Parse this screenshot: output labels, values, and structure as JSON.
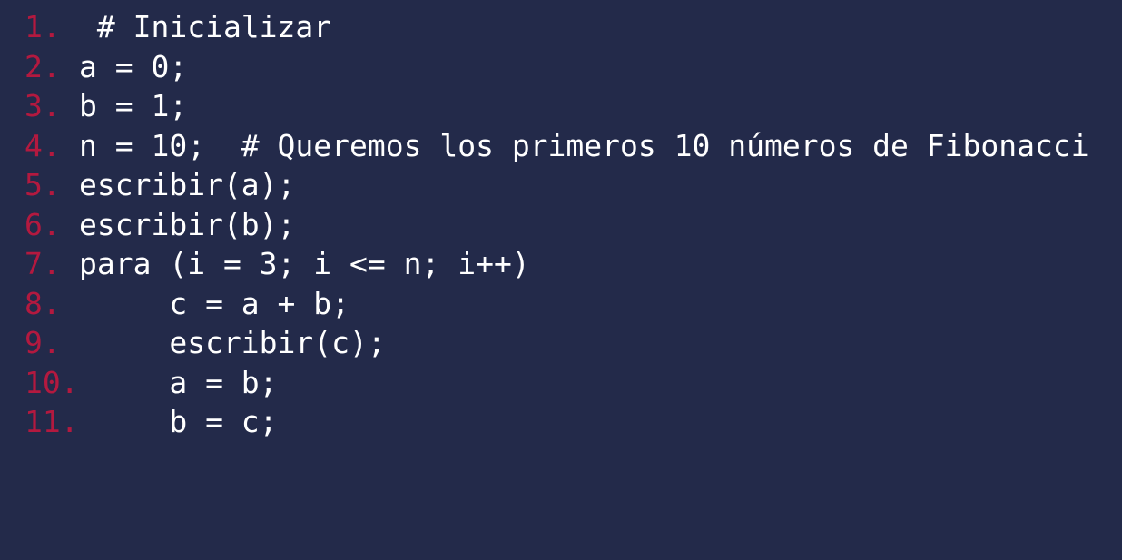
{
  "editor": {
    "background": "#232a4a",
    "line_number_color": "#b3193f",
    "text_color": "#ffffff",
    "lines": [
      {
        "number": "1.",
        "code": " # Inicializar"
      },
      {
        "number": "2.",
        "code": "a = 0;"
      },
      {
        "number": "3.",
        "code": "b = 1;"
      },
      {
        "number": "4.",
        "code": "n = 10;  # Queremos los primeros 10 números de Fibonacci"
      },
      {
        "number": "5.",
        "code": "escribir(a);"
      },
      {
        "number": "6.",
        "code": "escribir(b);"
      },
      {
        "number": "7.",
        "code": "para (i = 3; i <= n; i++)"
      },
      {
        "number": "8.",
        "code": "     c = a + b;"
      },
      {
        "number": "9.",
        "code": "     escribir(c);"
      },
      {
        "number": "10.",
        "code": "     a = b;"
      },
      {
        "number": "11.",
        "code": "     b = c;"
      }
    ]
  }
}
